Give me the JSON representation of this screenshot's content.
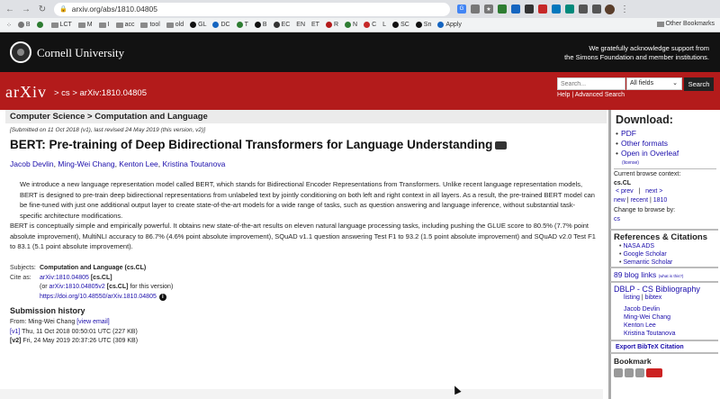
{
  "browser": {
    "url": "arxiv.org/abs/1810.04805",
    "bookmarks": [
      "B",
      "LCT",
      "M",
      "I",
      "acc",
      "tool",
      "old",
      "GL",
      "DC",
      "T",
      "B",
      "EC",
      "EN",
      "ET",
      "R",
      "N",
      "C",
      "L",
      "SC",
      "Sn",
      "Apply"
    ],
    "other_bookmarks": "Other Bookmarks"
  },
  "cornell": {
    "name": "Cornell University",
    "ack_line1": "We gratefully acknowledge support from",
    "ack_line2": "the Simons Foundation and member institutions."
  },
  "banner": {
    "logo": "arXiv",
    "breadcrumb": "> cs > arXiv:1810.04805",
    "search_placeholder": "Search...",
    "search_field": "All fields",
    "search_button": "Search",
    "help": "Help",
    "sep": "|",
    "advanced": "Advanced Search"
  },
  "paper": {
    "subject_bar": "Computer Science > Computation and Language",
    "submitted": "[Submitted on 11 Oct 2018 (v1), last revised 24 May 2019 (this version, v2)]",
    "title": "BERT: Pre-training of Deep Bidirectional Transformers for Language Understanding",
    "authors": [
      "Jacob Devlin",
      "Ming-Wei Chang",
      "Kenton Lee",
      "Kristina Toutanova"
    ],
    "abstract_p1": "We introduce a new language representation model called BERT, which stands for Bidirectional Encoder Representations from Transformers. Unlike recent language representation models, BERT is designed to pre-train deep bidirectional representations from unlabeled text by jointly conditioning on both left and right context in all layers. As a result, the pre-trained BERT model can be fine-tuned with just one additional output layer to create state-of-the-art models for a wide range of tasks, such as question answering and language inference, without substantial task-specific architecture modifications.",
    "abstract_p2": "BERT is conceptually simple and empirically powerful. It obtains new state-of-the-art results on eleven natural language processing tasks, including pushing the GLUE score to 80.5% (7.7% point absolute improvement), MultiNLI accuracy to 86.7% (4.6% point absolute improvement), SQuAD v1.1 question answering Test F1 to 93.2 (1.5 point absolute improvement) and SQuAD v2.0 Test F1 to 83.1 (5.1 point absolute improvement).",
    "subjects_key": "Subjects:",
    "subjects_val": "Computation and Language (cs.CL)",
    "cite_key": "Cite as:",
    "cite_id": "arXiv:1810.04805",
    "cite_tag": "[cs.CL]",
    "cite_or": "(or",
    "cite_v2": "arXiv:1810.04805v2",
    "cite_v2_tail": "for this version)",
    "doi": "https://doi.org/10.48550/arXiv.1810.04805",
    "history_heading": "Submission history",
    "history_from": "From: Ming-Wei Chang",
    "view_email": "[view email]",
    "v1_tag": "[v1]",
    "v1_text": "Thu, 11 Oct 2018 00:50:01 UTC (227 KB)",
    "v2_tag": "[v2]",
    "v2_text": "Fri, 24 May 2019 20:37:26 UTC (309 KB)"
  },
  "sidebar": {
    "download_heading": "Download:",
    "downloads": [
      "PDF",
      "Other formats",
      "Open in Overleaf"
    ],
    "license": "(license)",
    "current_context_label": "Current browse context:",
    "current_context": "cs.CL",
    "prev": "< prev",
    "next": "next >",
    "new": "new",
    "recent": "recent",
    "year": "1810",
    "change_label": "Change to browse by:",
    "change_cs": "cs",
    "refs_heading": "References & Citations",
    "refs": [
      "NASA ADS",
      "Google Scholar",
      "Semantic Scholar"
    ],
    "blog_links": "89 blog links",
    "blog_what": "(what is this?)",
    "dblp_heading": "DBLP - CS Bibliography",
    "dblp_listing": "listing",
    "dblp_bibtex": "bibtex",
    "dblp_authors": [
      "Jacob Devlin",
      "Ming-Wei Chang",
      "Kenton Lee",
      "Kristina Toutanova"
    ],
    "export_bibtex": "Export BibTeX Citation",
    "bookmark_heading": "Bookmark"
  }
}
